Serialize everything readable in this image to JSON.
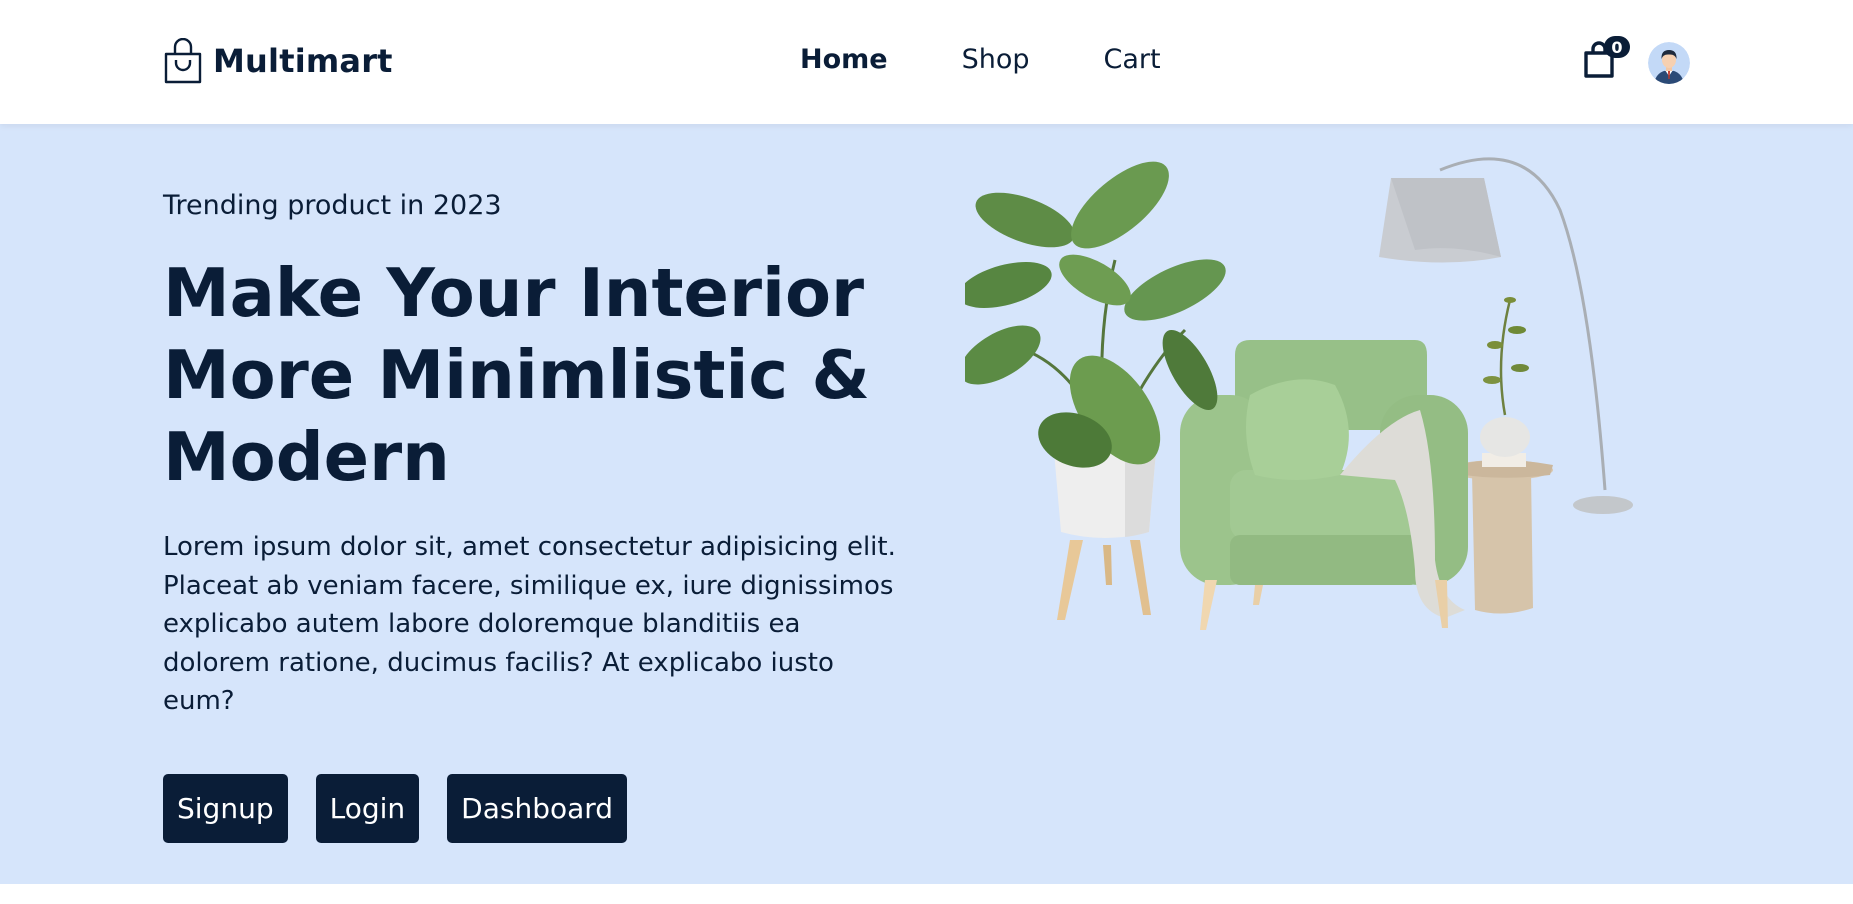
{
  "brand": {
    "name": "Multimart",
    "logo_icon": "shopping-bag-icon"
  },
  "nav": {
    "items": [
      {
        "label": "Home",
        "active": true
      },
      {
        "label": "Shop",
        "active": false
      },
      {
        "label": "Cart",
        "active": false
      }
    ]
  },
  "header_actions": {
    "cart_icon": "cart-bag-icon",
    "cart_count": "0",
    "avatar_icon": "user-avatar"
  },
  "hero": {
    "subtitle": "Trending product in 2023",
    "title": "Make Your Interior More Minimlistic & Modern",
    "description": "Lorem ipsum dolor sit, amet consectetur adipisicing elit. Placeat ab veniam facere, similique ex, iure dignissimos explicabo autem labore doloremque blanditiis ea dolorem ratione, ducimus facilis? At explicabo iusto eum?",
    "buttons": [
      "Signup",
      "Login",
      "Dashboard"
    ]
  },
  "colors": {
    "primary": "#0a1d37",
    "hero_background": "#d6e5fb",
    "chair_green": "#9cc48c"
  }
}
